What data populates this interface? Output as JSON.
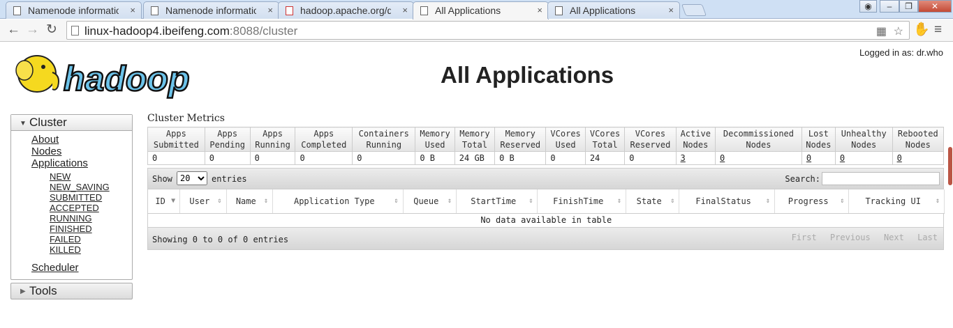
{
  "browser": {
    "tabs": [
      {
        "label": "Namenode information",
        "active": false
      },
      {
        "label": "Namenode information",
        "active": false
      },
      {
        "label": "hadoop.apache.org/doc",
        "active": false
      },
      {
        "label": "All Applications",
        "active": true
      },
      {
        "label": "All Applications",
        "active": false
      }
    ],
    "close_glyph": "×",
    "url_host": "linux-hadoop4.ibeifeng.com",
    "url_rest": ":8088/cluster"
  },
  "page": {
    "logged_in": "Logged in as: dr.who",
    "logo_text": "hadoop",
    "title": "All Applications"
  },
  "nav": {
    "cluster_label": "Cluster",
    "items": [
      "About",
      "Nodes",
      "Applications"
    ],
    "app_states": [
      "NEW",
      "NEW_SAVING",
      "SUBMITTED",
      "ACCEPTED",
      "RUNNING",
      "FINISHED",
      "FAILED",
      "KILLED"
    ],
    "scheduler": "Scheduler",
    "tools_label": "Tools"
  },
  "metrics": {
    "title": "Cluster Metrics",
    "columns": [
      {
        "h1": "Apps",
        "h2": "Submitted",
        "value": "0",
        "link": false
      },
      {
        "h1": "Apps",
        "h2": "Pending",
        "value": "0",
        "link": false
      },
      {
        "h1": "Apps",
        "h2": "Running",
        "value": "0",
        "link": false
      },
      {
        "h1": "Apps",
        "h2": "Completed",
        "value": "0",
        "link": false
      },
      {
        "h1": "Containers",
        "h2": "Running",
        "value": "0",
        "link": false
      },
      {
        "h1": "Memory",
        "h2": "Used",
        "value": "0 B",
        "link": false
      },
      {
        "h1": "Memory",
        "h2": "Total",
        "value": "24 GB",
        "link": false
      },
      {
        "h1": "Memory",
        "h2": "Reserved",
        "value": "0 B",
        "link": false
      },
      {
        "h1": "VCores",
        "h2": "Used",
        "value": "0",
        "link": false
      },
      {
        "h1": "VCores",
        "h2": "Total",
        "value": "24",
        "link": false
      },
      {
        "h1": "VCores",
        "h2": "Reserved",
        "value": "0",
        "link": false
      },
      {
        "h1": "Active",
        "h2": "Nodes",
        "value": "3",
        "link": true
      },
      {
        "h1": "Decommissioned",
        "h2": "Nodes",
        "value": "0",
        "link": true
      },
      {
        "h1": "Lost",
        "h2": "Nodes",
        "value": "0",
        "link": true
      },
      {
        "h1": "Unhealthy",
        "h2": "Nodes",
        "value": "0",
        "link": true
      },
      {
        "h1": "Rebooted",
        "h2": "Nodes",
        "value": "0",
        "link": true
      }
    ]
  },
  "table": {
    "show_label": "Show",
    "page_size": "20",
    "entries_label": "entries",
    "search_label": "Search:",
    "search_value": "",
    "columns": [
      "ID",
      "User",
      "Name",
      "Application Type",
      "Queue",
      "StartTime",
      "FinishTime",
      "State",
      "FinalStatus",
      "Progress",
      "Tracking UI"
    ],
    "empty_text": "No data available in table",
    "info": "Showing 0 to 0 of 0 entries",
    "pager": [
      "First",
      "Previous",
      "Next",
      "Last"
    ]
  }
}
